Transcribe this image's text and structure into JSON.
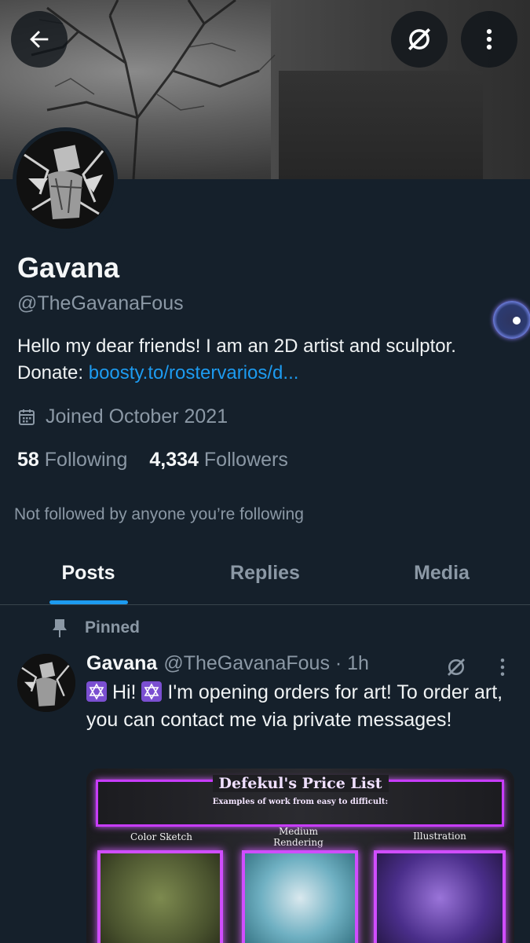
{
  "profile": {
    "name": "Gavana",
    "handle": "@TheGavanaFous",
    "bio_text": "Hello my dear friends! I am an 2D artist and sculptor. Donate: ",
    "bio_link": "boosty.to/rostervarios/d...",
    "joined": "Joined October 2021",
    "following_count": "58",
    "following_label": "Following",
    "followers_count": "4,334",
    "followers_label": "Followers",
    "not_followed": "Not followed by anyone you’re following"
  },
  "header": {
    "back_icon": "arrow-left-icon",
    "grok_icon": "grok-icon",
    "more_icon": "more-vertical-icon"
  },
  "tabs": [
    {
      "label": "Posts",
      "active": true
    },
    {
      "label": "Replies",
      "active": false
    },
    {
      "label": "Media",
      "active": false
    }
  ],
  "pinned_post": {
    "pinned_label": "Pinned",
    "author_name": "Gavana",
    "author_handle": "@TheGavanaFous · 1h",
    "text_1": " Hi! ",
    "text_2": " I'm opening orders for art! To order art, you can contact me via private messages!",
    "media": {
      "title": "Defekul's Price List",
      "subtitle": "Examples of work from easy to difficult:",
      "columns": [
        "Color Sketch",
        "Medium Rendering",
        "Illustration"
      ]
    }
  },
  "colors": {
    "background": "#15202b",
    "accent": "#1d9bf0",
    "muted": "#8b98a5",
    "neon": "#d04dff"
  }
}
